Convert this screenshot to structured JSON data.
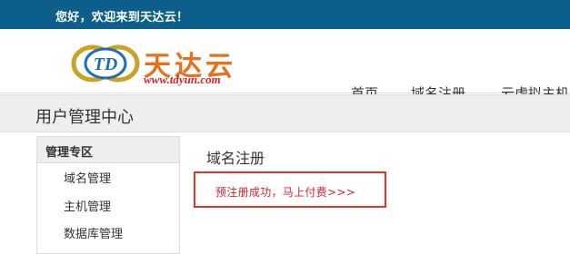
{
  "topbar": {
    "greeting": "您好，欢迎来到天达云！"
  },
  "logo": {
    "mark": "TD",
    "name_cn": "天达云",
    "url": "www.tdyun.com"
  },
  "nav": [
    {
      "label": "首页"
    },
    {
      "label": "域名注册"
    },
    {
      "label": "云虚拟主机"
    }
  ],
  "page": {
    "subtitle": "用户管理中心"
  },
  "sidebar": {
    "title": "管理专区",
    "items": [
      {
        "label": "域名管理"
      },
      {
        "label": "主机管理"
      },
      {
        "label": "数据库管理"
      }
    ]
  },
  "main": {
    "title": "域名注册",
    "notice_link": "预注册成功，马上付费>>>"
  },
  "colors": {
    "topbar": "#0b5f8a",
    "brand_orange": "#e8701a",
    "brand_red": "#d9222a",
    "notice_border": "#e2342b"
  }
}
